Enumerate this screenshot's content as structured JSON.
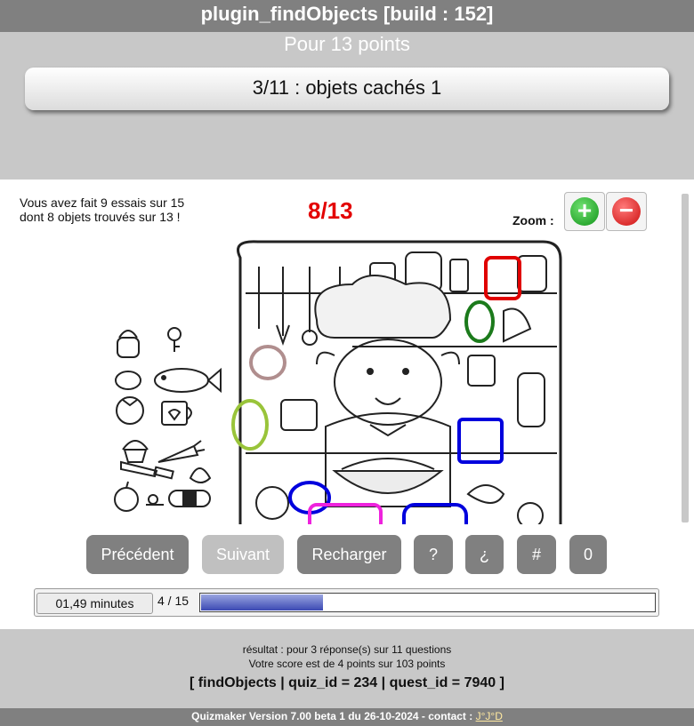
{
  "header": {
    "title": "plugin_findObjects [build : 152]",
    "points": "Pour 13 points",
    "question": "3/11 : objets cachés 1"
  },
  "game": {
    "info_line1": "Vous avez fait 9 essais sur 15",
    "info_line2": "dont 8 objets trouvés sur 13 !",
    "score": "8/13",
    "zoom_label": "Zoom :",
    "zoom_in_symbol": "+",
    "zoom_out_symbol": "−"
  },
  "buttons": {
    "previous": "Précédent",
    "next": "Suivant",
    "reload": "Recharger",
    "help": "?",
    "inverted_help": "¿",
    "hash": "#",
    "zero": "0"
  },
  "progress": {
    "timer": "01,49 minutes",
    "counter": "4 / 15",
    "fill_percent": 27
  },
  "footer": {
    "result_line": "résultat : pour 3 réponse(s) sur 11 questions",
    "score_line": "Votre score est de 4 points sur 103 points",
    "ids_line": "[ findObjects | quiz_id = 234 | quest_id = 7940 ]",
    "version": "Quizmaker Version 7.00 beta 1 du 26-10-2024 - contact : ",
    "contact": "J°J°D"
  },
  "colors": {
    "accent_score": "#e30000",
    "zoom_in": "#1aa51a",
    "zoom_out": "#d81414",
    "progress_fill": "#3b49b3",
    "found_marker_red": "#e00000",
    "found_marker_green": "#1b7a1b",
    "found_marker_blue": "#0000dd",
    "found_marker_magenta": "#ee22dd",
    "found_marker_lime": "#99c43a",
    "found_marker_taupe": "#b08e8e"
  },
  "icons": {
    "zoom_in": "plus-circle-icon",
    "zoom_out": "minus-circle-icon"
  }
}
